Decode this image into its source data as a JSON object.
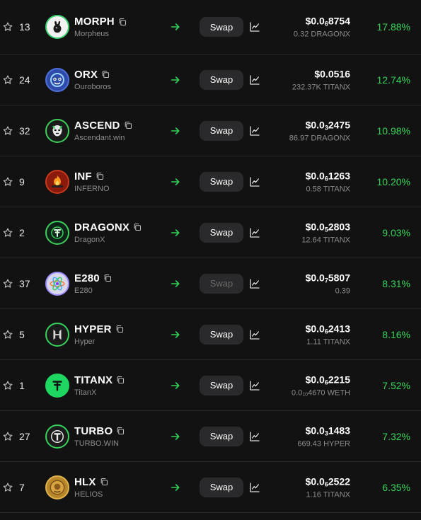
{
  "colors": {
    "background": "#121212",
    "positive": "#35d35a",
    "arrow": "#35d35a",
    "swap_bg": "#2a2a2c",
    "muted": "#8c8c8c"
  },
  "rows": [
    {
      "rank": "13",
      "symbol": "MORPH",
      "name": "Morpheus",
      "logo_icon": "rabbit-icon",
      "price_prefix": "$0.0",
      "price_zeros": "6",
      "price_digits": "8754",
      "amount_prefix": "0.32 DRAGONX",
      "amount_zeros": "",
      "amount_suffix": "",
      "change": "17.88%",
      "swap_label": "Swap",
      "swap_enabled": true
    },
    {
      "rank": "24",
      "symbol": "ORX",
      "name": "Ouroboros",
      "logo_icon": "ouroboros-face-icon",
      "price_prefix": "$0.0516",
      "price_zeros": "",
      "price_digits": "",
      "amount_prefix": "232.37K TITANX",
      "amount_zeros": "",
      "amount_suffix": "",
      "change": "12.74%",
      "swap_label": "Swap",
      "swap_enabled": true
    },
    {
      "rank": "32",
      "symbol": "ASCEND",
      "name": "Ascendant.win",
      "logo_icon": "ascendant-mask-icon",
      "price_prefix": "$0.0",
      "price_zeros": "3",
      "price_digits": "2475",
      "amount_prefix": "86.97 DRAGONX",
      "amount_zeros": "",
      "amount_suffix": "",
      "change": "10.98%",
      "swap_label": "Swap",
      "swap_enabled": true
    },
    {
      "rank": "9",
      "symbol": "INF",
      "name": "INFERNO",
      "logo_icon": "inferno-icon",
      "price_prefix": "$0.0",
      "price_zeros": "6",
      "price_digits": "1263",
      "amount_prefix": "0.58 TITANX",
      "amount_zeros": "",
      "amount_suffix": "",
      "change": "10.20%",
      "swap_label": "Swap",
      "swap_enabled": true
    },
    {
      "rank": "2",
      "symbol": "DRAGONX",
      "name": "DragonX",
      "logo_icon": "dragonx-icon",
      "price_prefix": "$0.0",
      "price_zeros": "5",
      "price_digits": "2803",
      "amount_prefix": "12.64 TITANX",
      "amount_zeros": "",
      "amount_suffix": "",
      "change": "9.03%",
      "swap_label": "Swap",
      "swap_enabled": true
    },
    {
      "rank": "37",
      "symbol": "E280",
      "name": "E280",
      "logo_icon": "atom-icon",
      "price_prefix": "$0.0",
      "price_zeros": "7",
      "price_digits": "5807",
      "amount_prefix": "0.39",
      "amount_zeros": "",
      "amount_suffix": "",
      "change": "8.31%",
      "swap_label": "Swap",
      "swap_enabled": false
    },
    {
      "rank": "5",
      "symbol": "HYPER",
      "name": "Hyper",
      "logo_icon": "hyper-h-icon",
      "price_prefix": "$0.0",
      "price_zeros": "6",
      "price_digits": "2413",
      "amount_prefix": "1.11 TITANX",
      "amount_zeros": "",
      "amount_suffix": "",
      "change": "8.16%",
      "swap_label": "Swap",
      "swap_enabled": true
    },
    {
      "rank": "1",
      "symbol": "TITANX",
      "name": "TitanX",
      "logo_icon": "titanx-icon",
      "price_prefix": "$0.0",
      "price_zeros": "6",
      "price_digits": "2215",
      "amount_prefix": "0.0",
      "amount_zeros": "10",
      "amount_suffix": "4670 WETH",
      "change": "7.52%",
      "swap_label": "Swap",
      "swap_enabled": true
    },
    {
      "rank": "27",
      "symbol": "TURBO",
      "name": "TURBO.WIN",
      "logo_icon": "turbo-t-icon",
      "price_prefix": "$0.0",
      "price_zeros": "3",
      "price_digits": "1483",
      "amount_prefix": "669.43 HYPER",
      "amount_zeros": "",
      "amount_suffix": "",
      "change": "7.32%",
      "swap_label": "Swap",
      "swap_enabled": true
    },
    {
      "rank": "7",
      "symbol": "HLX",
      "name": "HELIOS",
      "logo_icon": "helios-coin-icon",
      "price_prefix": "$0.0",
      "price_zeros": "6",
      "price_digits": "2522",
      "amount_prefix": "1.16 TITANX",
      "amount_zeros": "",
      "amount_suffix": "",
      "change": "6.35%",
      "swap_label": "Swap",
      "swap_enabled": true
    }
  ]
}
